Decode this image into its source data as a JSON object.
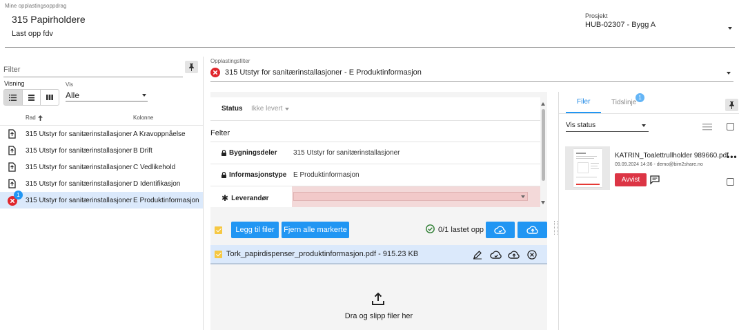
{
  "header": {
    "breadcrumb": "Mine opplastingsoppdrag",
    "title": "315 Papirholdere",
    "subtitle": "Last opp fdv",
    "project_label": "Prosjekt",
    "project_value": "HUB-02307 - Bygg A"
  },
  "left": {
    "filter_placeholder": "Filter",
    "visning_label": "Visning",
    "vis_label": "Vis",
    "vis_value": "Alle",
    "col_rad": "Rad",
    "col_kolonne": "Kolonne",
    "rows": [
      {
        "rad": "315 Utstyr for sanitærinstallasjoner",
        "kolonne": "A Kravoppnåelse"
      },
      {
        "rad": "315 Utstyr for sanitærinstallasjoner",
        "kolonne": "B Drift"
      },
      {
        "rad": "315 Utstyr for sanitærinstallasjoner",
        "kolonne": "C Vedlikehold"
      },
      {
        "rad": "315 Utstyr for sanitærinstallasjoner",
        "kolonne": "D Identifikasjon"
      },
      {
        "rad": "315 Utstyr for sanitærinstallasjoner",
        "kolonne": "E Produktinformasjon"
      }
    ],
    "selected_badge": "1"
  },
  "middle": {
    "filter_label": "Opplastingsfilter",
    "filter_value": "315 Utstyr for sanitærinstallasjoner - E Produktinformasjon",
    "status_label": "Status",
    "status_value": "Ikke levert",
    "felter_label": "Felter",
    "fields": [
      {
        "label": "Bygningsdeler",
        "value": "315 Utstyr for sanitærinstallasjoner"
      },
      {
        "label": "Informasjonstype",
        "value": "E Produktinformasjon"
      },
      {
        "label": "Leverandør",
        "value": ""
      }
    ],
    "add_files_button": "Legg til filer",
    "remove_marked_button": "Fjern alle markerte",
    "upload_status": "0/1 lastet opp",
    "file_item": "Tork_papirdispenser_produktinformasjon.pdf - 915.23 KB",
    "dropzone_text": "Dra og slipp filer her"
  },
  "right": {
    "tab_files": "Filer",
    "tab_timeline": "Tidslinje",
    "tab_timeline_badge": "1",
    "vis_status": "Vis status",
    "file_name": "KATRIN_Toalettrullholder 989660.pdf",
    "file_meta": "09.09.2024 14:36 - demo@bim2share.no",
    "rejected_button": "Avvist"
  },
  "colors": {
    "accent_blue": "#2196f3",
    "selected_row": "#dbe9fb",
    "error_red": "#e0262c",
    "rejected_red": "#dc3545",
    "check_yellow": "#f6c843",
    "required_bg": "#f3d9d9"
  }
}
